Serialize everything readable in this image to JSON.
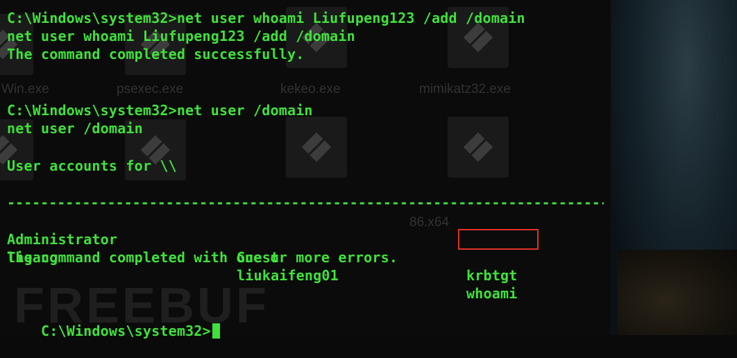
{
  "terminal": {
    "cmd1": "C:\\Windows\\system32>net user whoami Liufupeng123 /add /domain",
    "echo1": "net user whoami Liufupeng123 /add /domain",
    "result1": "The command completed successfully.",
    "cmd2": "C:\\Windows\\system32>net user /domain",
    "echo2": "net user /domain",
    "accounts_header": "User accounts for \\\\",
    "separator": "-------------------------------------------------------------------------------",
    "accounts": [
      [
        "Administrator",
        "Guest",
        "krbtgt"
      ],
      [
        "ligang",
        "liukaifeng01",
        "whoami"
      ]
    ],
    "result2": "The command completed with one or more errors.",
    "prompt": "C:\\Windows\\system32>"
  },
  "background": {
    "file_labels": [
      "Win.exe",
      "psexec.exe",
      "kekeo.exe",
      "mimikatz32.exe"
    ],
    "label_86": "86.x64",
    "watermark": "FREEBUF",
    "icon_name": "app-icon"
  },
  "colors": {
    "terminal_text": "#3fe23a",
    "highlight": "#e0312b"
  }
}
